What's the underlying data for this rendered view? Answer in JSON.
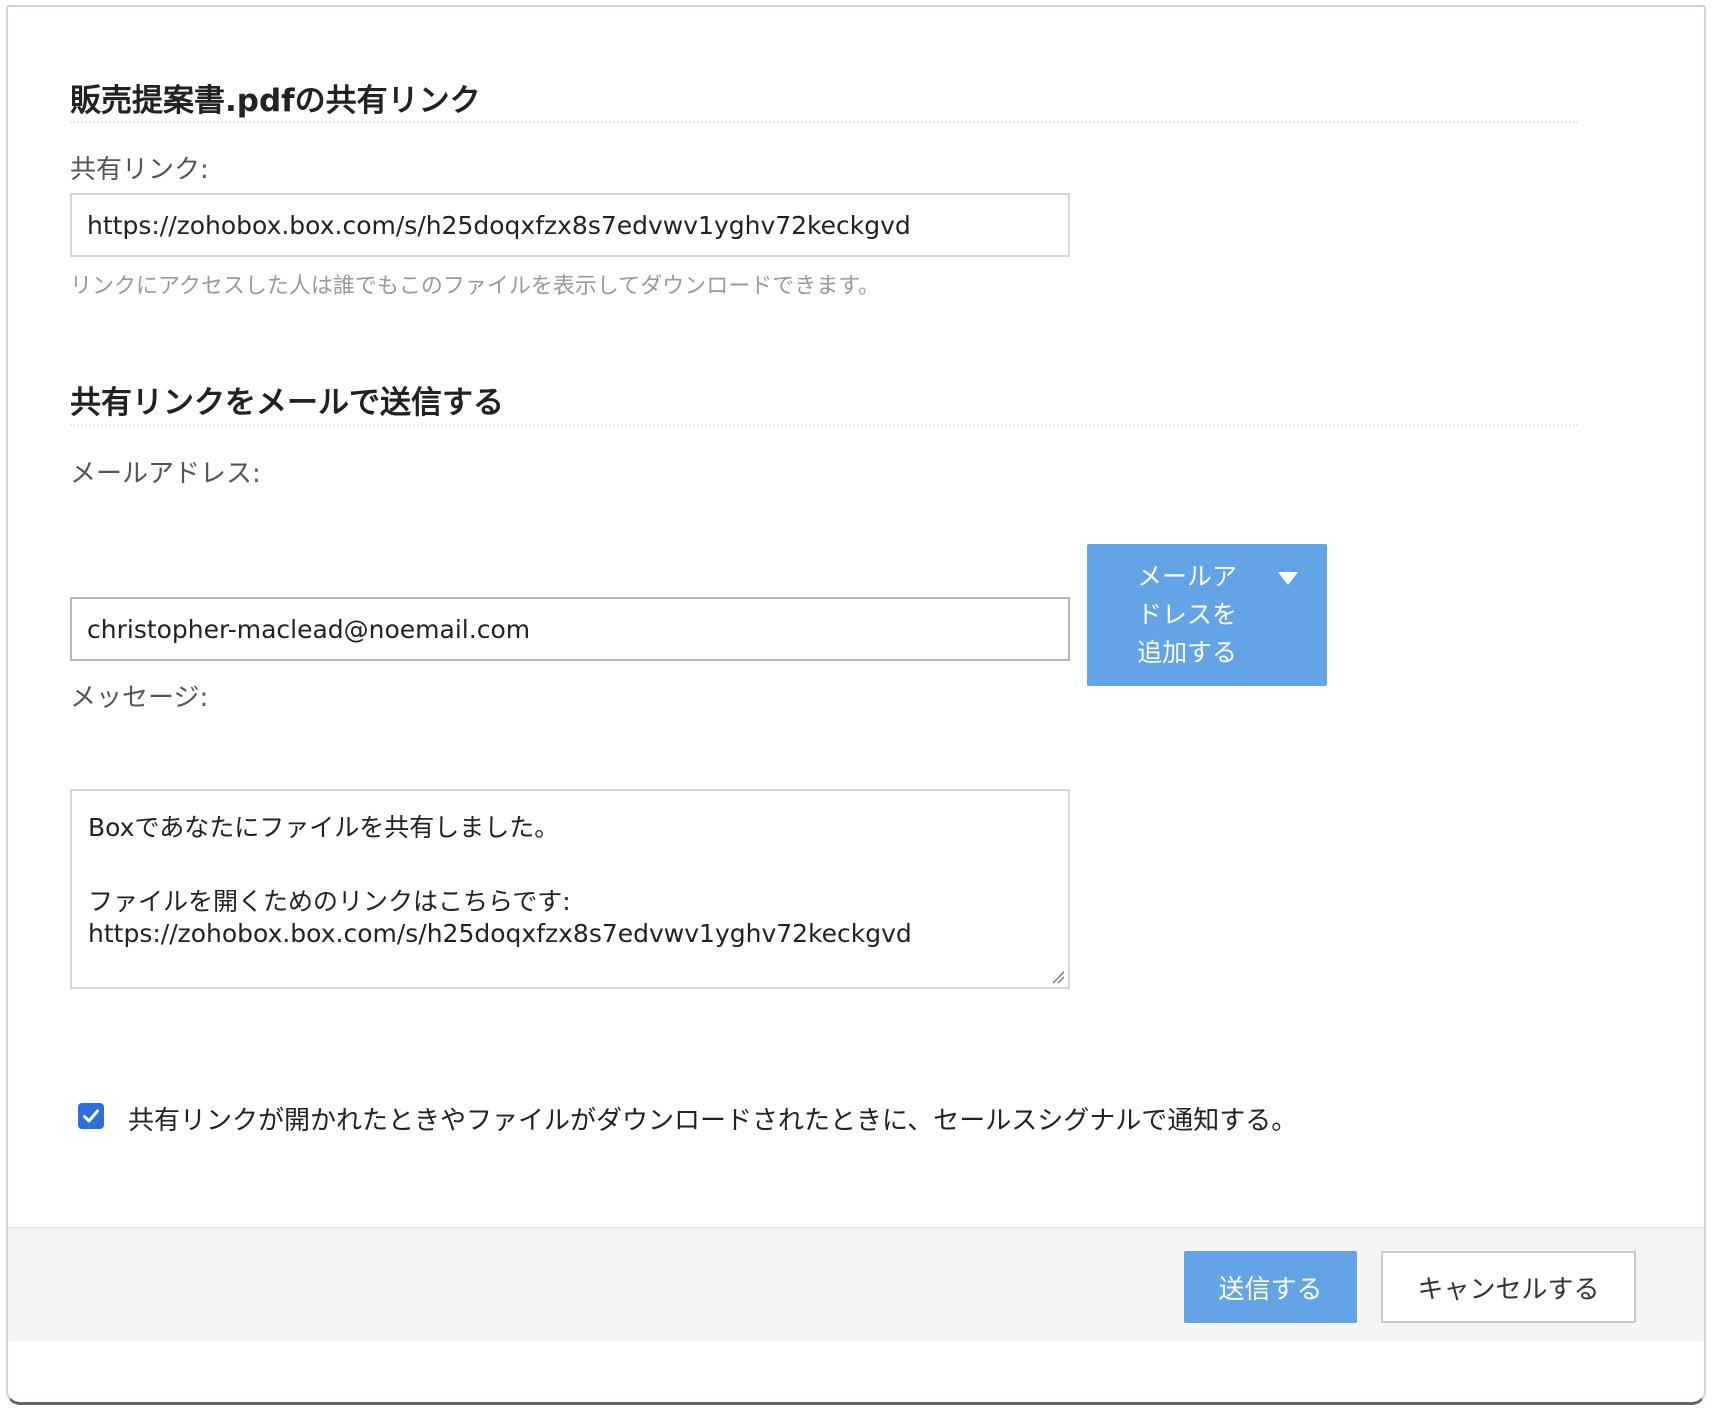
{
  "dialog": {
    "title": "販売提案書.pdfの共有リンク"
  },
  "share_link": {
    "label": "共有リンク:",
    "value": "https://zohobox.box.com/s/h25doqxfzx8s7edvwv1yghv72keckgvd",
    "help": "リンクにアクセスした人は誰でもこのファイルを表示してダウンロードできます。"
  },
  "email_section": {
    "title": "共有リンクをメールで送信する",
    "email_label": "メールアドレス:",
    "email_value": "christopher-maclead@noemail.com",
    "add_email_button": "メールアドレスを追加する",
    "message_label": "メッセージ:",
    "message_lines": [
      "Boxであなたにファイルを共有しました。",
      "ファイルを開くためのリンクはこちらです:",
      "https://zohobox.box.com/s/h25doqxfzx8s7edvwv1yghv72keckgvd"
    ]
  },
  "notify": {
    "checked": true,
    "label": "共有リンクが開かれたときやファイルがダウンロードされたときに、セールスシグナルで通知する。"
  },
  "footer": {
    "send_button": "送信する",
    "cancel_button": "キャンセルする"
  },
  "colors": {
    "primary_button": "#62a4e6",
    "checkbox": "#2f6fde",
    "footer_background": "#f4f4f4"
  }
}
